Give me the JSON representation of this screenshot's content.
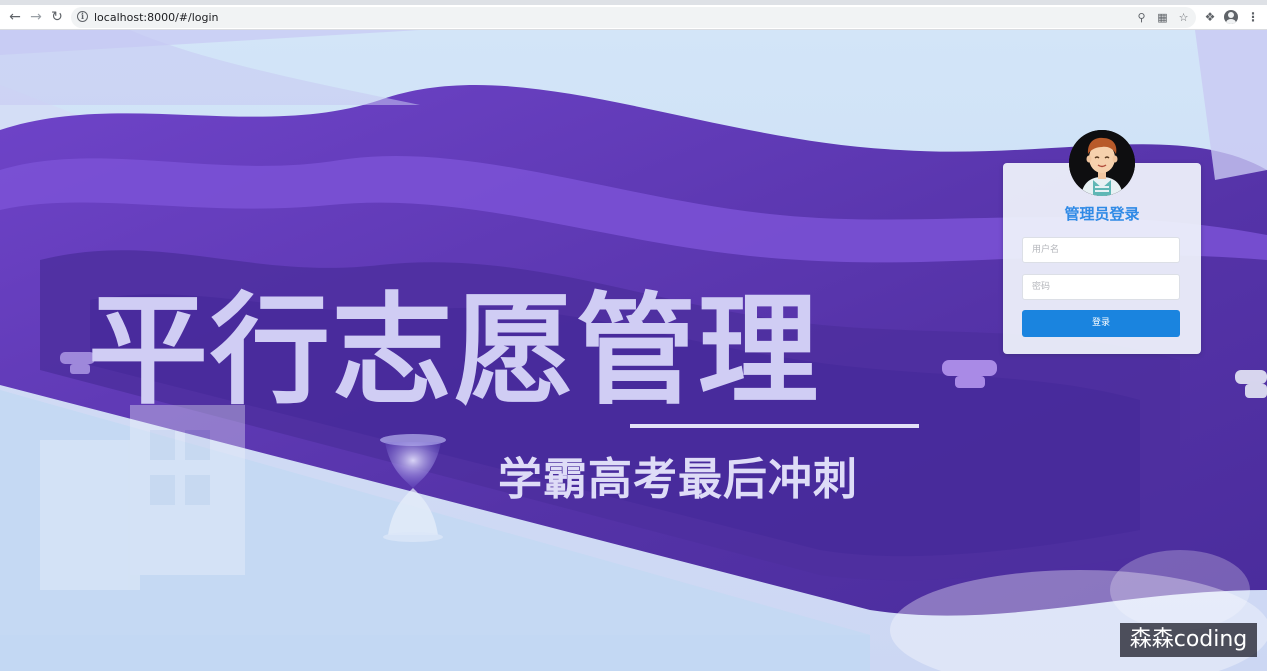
{
  "browser": {
    "url": "localhost:8000/#/login",
    "icons": [
      "back-icon",
      "forward-icon",
      "reload-icon",
      "site-info-icon",
      "key-icon",
      "translate-icon",
      "star-icon",
      "extensions-icon",
      "profile-icon",
      "menu-icon"
    ]
  },
  "hero": {
    "title": "平行志愿管理",
    "subtitle": "学霸高考最后冲刺"
  },
  "login": {
    "title": "管理员登录",
    "username_placeholder": "用户名",
    "password_placeholder": "密码",
    "submit_label": "登录"
  },
  "watermark": "森森coding",
  "colors": {
    "accent": "#2f8ae6",
    "button": "#1a84df",
    "purple": "#5b3bb0",
    "sky": "#cfe2f7"
  }
}
